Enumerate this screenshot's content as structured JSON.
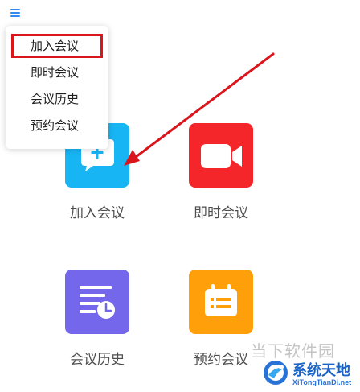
{
  "menu": {
    "items": [
      {
        "label": "加入会议",
        "highlighted": true
      },
      {
        "label": "即时会议",
        "highlighted": false
      },
      {
        "label": "会议历史",
        "highlighted": false
      },
      {
        "label": "预约会议",
        "highlighted": false
      }
    ]
  },
  "tiles": [
    {
      "label": "加入会议",
      "icon": "chat-plus-icon",
      "color": "#17b5f4"
    },
    {
      "label": "即时会议",
      "icon": "video-camera-icon",
      "color": "#f5262a"
    },
    {
      "label": "会议历史",
      "icon": "list-clock-icon",
      "color": "#7467ec"
    },
    {
      "label": "预约会议",
      "icon": "calendar-icon",
      "color": "#ff9f0a"
    }
  ],
  "colors": {
    "accent": "#2f8af5",
    "highlight_border": "#d9161b",
    "annotation_arrow": "#d9161b"
  },
  "watermark": {
    "top_text": "当下软件园",
    "brand": "系统天地",
    "url": "XiTongTianDi.net"
  }
}
